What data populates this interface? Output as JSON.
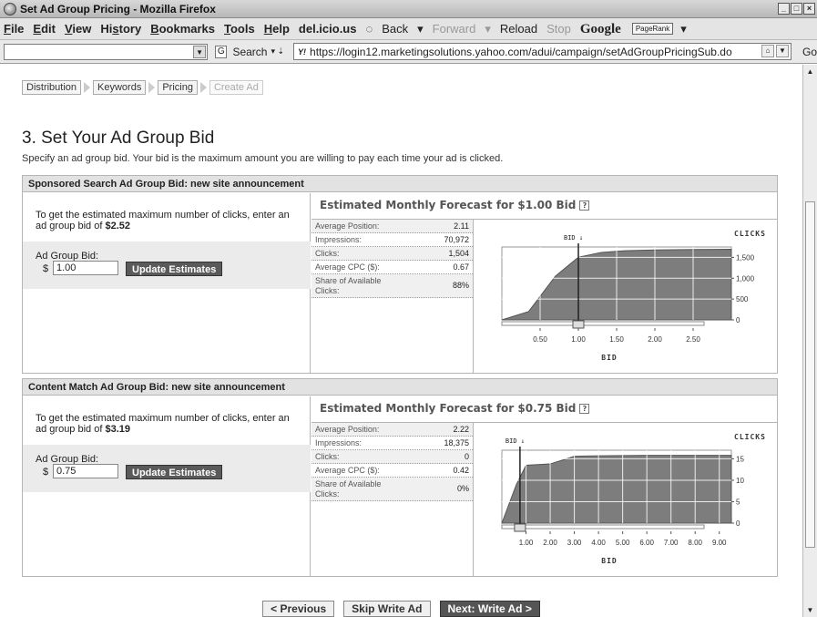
{
  "window": {
    "title": "Set Ad Group Pricing - Mozilla Firefox"
  },
  "menu": {
    "items": [
      {
        "u": "F",
        "rest": "ile"
      },
      {
        "u": "E",
        "rest": "dit"
      },
      {
        "u": "V",
        "rest": "iew"
      },
      {
        "pre": "Hi",
        "u": "s",
        "rest": "tory"
      },
      {
        "u": "B",
        "rest": "ookmarks"
      },
      {
        "u": "T",
        "rest": "ools"
      },
      {
        "u": "H",
        "rest": "elp"
      }
    ],
    "delicious": "del.icio.us",
    "back": "Back",
    "forward": "Forward",
    "reload": "Reload",
    "stop": "Stop",
    "google": "Google",
    "pagerank": "PageRank"
  },
  "nav": {
    "search_label": "Search",
    "url": "https://login12.marketingsolutions.yahoo.com/adui/campaign/setAdGroupPricingSub.do",
    "go": "Go"
  },
  "steps": [
    {
      "label": "Distribution",
      "active": true
    },
    {
      "label": "Keywords",
      "active": true
    },
    {
      "label": "Pricing",
      "active": true
    },
    {
      "label": "Create Ad",
      "active": false
    }
  ],
  "heading": "3. Set Your Ad Group Bid",
  "subtext": "Specify an ad group bid. Your bid is the maximum amount you are willing to pay each time your ad is clicked.",
  "sponsored": {
    "header": "Sponsored Search Ad Group Bid: new site announcement",
    "desc_prefix": "To get the estimated maximum number of clicks, enter an ad group bid of ",
    "desc_value": "$2.52",
    "bid_label": "Ad Group Bid:",
    "currency": "$",
    "bid_value": "1.00",
    "update": "Update Estimates",
    "forecast_title": "Estimated Monthly Forecast for $1.00 Bid",
    "help": "?",
    "stats": [
      {
        "label": "Average Position:",
        "value": "2.11"
      },
      {
        "label": "Impressions:",
        "value": "70,972"
      },
      {
        "label": "Clicks:",
        "value": "1,504"
      },
      {
        "label": "Average CPC ($):",
        "value": "0.67"
      },
      {
        "label": "Share of Available Clicks:",
        "value": "88%"
      }
    ]
  },
  "content_match": {
    "header": "Content Match Ad Group Bid: new site announcement",
    "desc_prefix": "To get the estimated maximum number of clicks, enter an ad group bid of ",
    "desc_value": "$3.19",
    "bid_label": "Ad Group Bid:",
    "currency": "$",
    "bid_value": "0.75",
    "update": "Update Estimates",
    "forecast_title": "Estimated Monthly Forecast for $0.75 Bid",
    "help": "?",
    "stats": [
      {
        "label": "Average Position:",
        "value": "2.22"
      },
      {
        "label": "Impressions:",
        "value": "18,375"
      },
      {
        "label": "Clicks:",
        "value": "0"
      },
      {
        "label": "Average CPC ($):",
        "value": "0.42"
      },
      {
        "label": "Share of Available Clicks:",
        "value": "0%"
      }
    ]
  },
  "chart_data": [
    {
      "type": "area",
      "xlabel": "BID",
      "ylabel": "CLICKS",
      "bid_marker_label": "BID",
      "current_bid": 1.0,
      "xlim": [
        0.0,
        3.0
      ],
      "ylim": [
        0,
        1750
      ],
      "xticks": [
        0.5,
        1.0,
        1.5,
        2.0,
        2.5
      ],
      "xticklabels": [
        "0.50",
        "1.00",
        "1.50",
        "2.00",
        "2.50"
      ],
      "yticks": [
        0,
        500,
        1000,
        1500
      ],
      "yticklabels": [
        "0",
        "500",
        "1,000",
        "1,500"
      ],
      "x": [
        0.0,
        0.35,
        0.7,
        1.0,
        1.3,
        1.6,
        2.0,
        2.5,
        3.0
      ],
      "y": [
        0,
        200,
        1050,
        1504,
        1620,
        1660,
        1680,
        1690,
        1695
      ],
      "grid": true
    },
    {
      "type": "area",
      "xlabel": "BID",
      "ylabel": "CLICKS",
      "bid_marker_label": "BID",
      "current_bid": 0.75,
      "xlim": [
        0.0,
        9.5
      ],
      "ylim": [
        0,
        17
      ],
      "xticks": [
        1,
        2,
        3,
        4,
        5,
        6,
        7,
        8,
        9
      ],
      "xticklabels": [
        "1.00",
        "2.00",
        "3.00",
        "4.00",
        "5.00",
        "6.00",
        "7.00",
        "8.00",
        "9.00"
      ],
      "yticks": [
        0,
        5,
        10,
        15
      ],
      "yticklabels": [
        "0",
        "5",
        "10",
        "15"
      ],
      "x": [
        0.0,
        0.6,
        1.0,
        2.0,
        3.0,
        4.0,
        6.0,
        8.0,
        9.5
      ],
      "y": [
        0,
        9,
        13.5,
        13.8,
        15.6,
        15.7,
        15.8,
        15.8,
        15.8
      ],
      "grid": true
    }
  ],
  "buttons": {
    "previous": "< Previous",
    "skip": "Skip Write Ad",
    "next": "Next: Write Ad >"
  }
}
